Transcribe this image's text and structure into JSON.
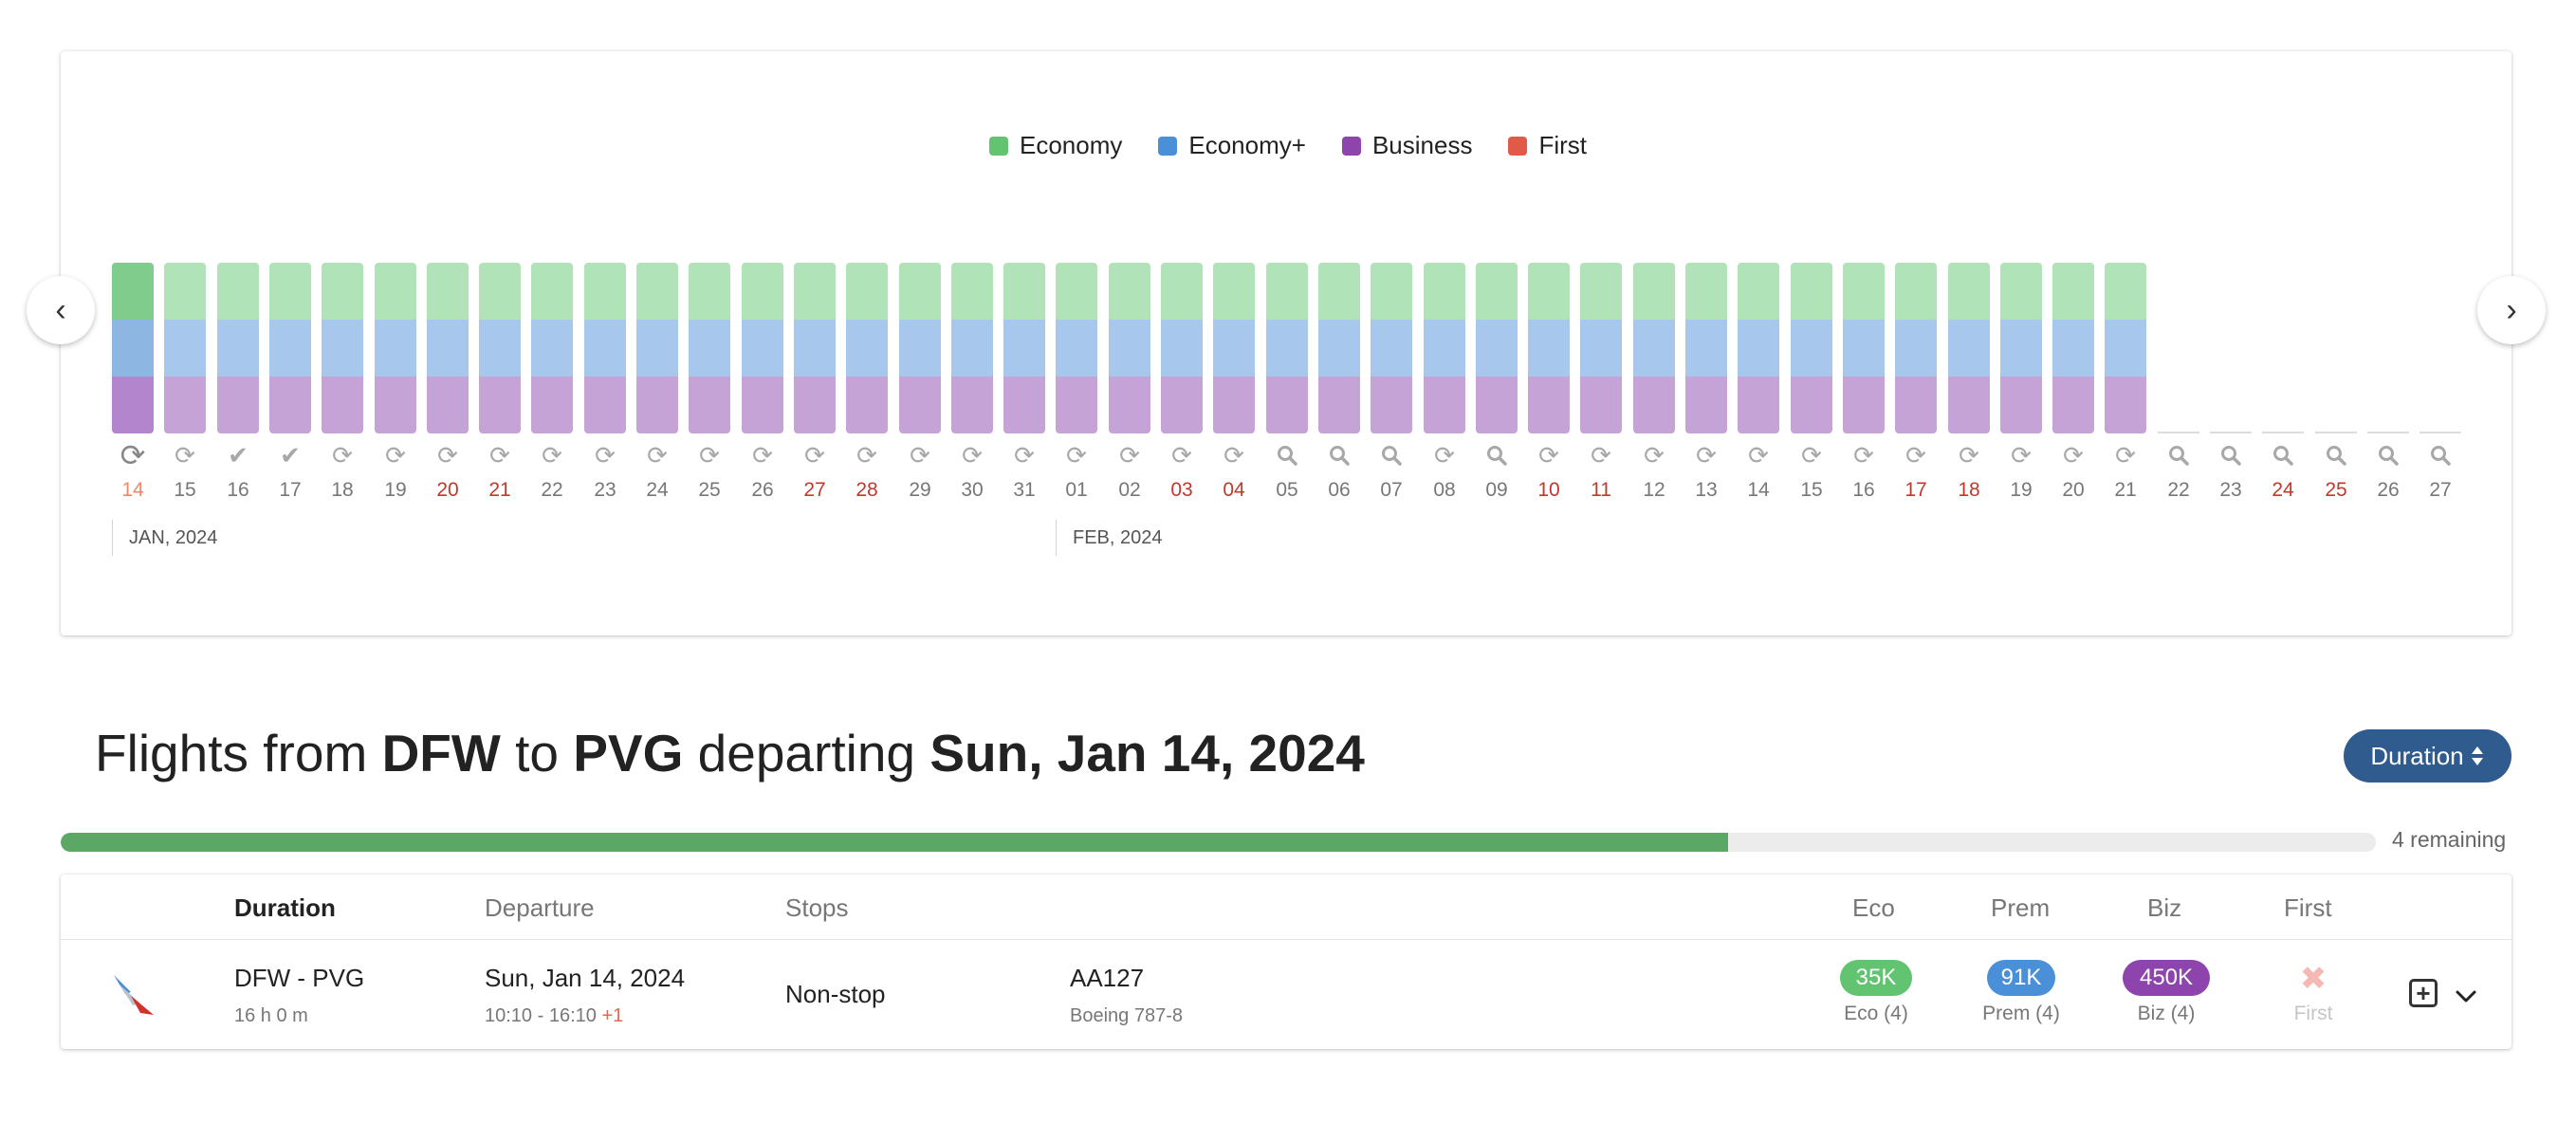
{
  "legend": [
    {
      "label": "Economy",
      "color": "#62c370"
    },
    {
      "label": "Economy+",
      "color": "#4a90d9"
    },
    {
      "label": "Business",
      "color": "#8e44ad"
    },
    {
      "label": "First",
      "color": "#e05a47"
    }
  ],
  "calendar": {
    "prev_icon": "chevron-left-icon",
    "next_icon": "chevron-right-icon",
    "bar_colors": {
      "economy": "#b1e3b9",
      "economy_plus": "#a7c8ec",
      "business": "#c5a3d6",
      "selected_economy": "#7fcc8c",
      "selected_economy_plus": "#8db6e3",
      "selected_business": "#b285cc"
    },
    "days": [
      {
        "label": "14",
        "status": "loading",
        "bar": true,
        "weekend": false,
        "selected": true
      },
      {
        "label": "15",
        "status": "refresh",
        "bar": true,
        "weekend": false
      },
      {
        "label": "16",
        "status": "done",
        "bar": true,
        "weekend": false
      },
      {
        "label": "17",
        "status": "done",
        "bar": true,
        "weekend": false
      },
      {
        "label": "18",
        "status": "refresh",
        "bar": true,
        "weekend": false
      },
      {
        "label": "19",
        "status": "refresh",
        "bar": true,
        "weekend": false
      },
      {
        "label": "20",
        "status": "refresh",
        "bar": true,
        "weekend": true
      },
      {
        "label": "21",
        "status": "refresh",
        "bar": true,
        "weekend": true
      },
      {
        "label": "22",
        "status": "refresh",
        "bar": true,
        "weekend": false
      },
      {
        "label": "23",
        "status": "refresh",
        "bar": true,
        "weekend": false
      },
      {
        "label": "24",
        "status": "refresh",
        "bar": true,
        "weekend": false
      },
      {
        "label": "25",
        "status": "refresh",
        "bar": true,
        "weekend": false
      },
      {
        "label": "26",
        "status": "refresh",
        "bar": true,
        "weekend": false
      },
      {
        "label": "27",
        "status": "refresh",
        "bar": true,
        "weekend": true
      },
      {
        "label": "28",
        "status": "refresh",
        "bar": true,
        "weekend": true
      },
      {
        "label": "29",
        "status": "refresh",
        "bar": true,
        "weekend": false
      },
      {
        "label": "30",
        "status": "refresh",
        "bar": true,
        "weekend": false
      },
      {
        "label": "31",
        "status": "refresh",
        "bar": true,
        "weekend": false
      },
      {
        "label": "01",
        "status": "refresh",
        "bar": true,
        "weekend": false
      },
      {
        "label": "02",
        "status": "refresh",
        "bar": true,
        "weekend": false
      },
      {
        "label": "03",
        "status": "refresh",
        "bar": true,
        "weekend": true
      },
      {
        "label": "04",
        "status": "refresh",
        "bar": true,
        "weekend": true
      },
      {
        "label": "05",
        "status": "search",
        "bar": true,
        "weekend": false
      },
      {
        "label": "06",
        "status": "search",
        "bar": true,
        "weekend": false
      },
      {
        "label": "07",
        "status": "search",
        "bar": true,
        "weekend": false
      },
      {
        "label": "08",
        "status": "refresh",
        "bar": true,
        "weekend": false
      },
      {
        "label": "09",
        "status": "search",
        "bar": true,
        "weekend": false
      },
      {
        "label": "10",
        "status": "refresh",
        "bar": true,
        "weekend": true
      },
      {
        "label": "11",
        "status": "refresh",
        "bar": true,
        "weekend": true
      },
      {
        "label": "12",
        "status": "refresh",
        "bar": true,
        "weekend": false
      },
      {
        "label": "13",
        "status": "refresh",
        "bar": true,
        "weekend": false
      },
      {
        "label": "14",
        "status": "refresh",
        "bar": true,
        "weekend": false
      },
      {
        "label": "15",
        "status": "refresh",
        "bar": true,
        "weekend": false
      },
      {
        "label": "16",
        "status": "refresh",
        "bar": true,
        "weekend": false
      },
      {
        "label": "17",
        "status": "refresh",
        "bar": true,
        "weekend": true
      },
      {
        "label": "18",
        "status": "refresh",
        "bar": true,
        "weekend": true
      },
      {
        "label": "19",
        "status": "refresh",
        "bar": true,
        "weekend": false
      },
      {
        "label": "20",
        "status": "refresh",
        "bar": true,
        "weekend": false
      },
      {
        "label": "21",
        "status": "refresh",
        "bar": true,
        "weekend": false
      },
      {
        "label": "22",
        "status": "search",
        "bar": false,
        "weekend": false
      },
      {
        "label": "23",
        "status": "search",
        "bar": false,
        "weekend": false
      },
      {
        "label": "24",
        "status": "search",
        "bar": false,
        "weekend": true
      },
      {
        "label": "25",
        "status": "search",
        "bar": false,
        "weekend": true
      },
      {
        "label": "26",
        "status": "search",
        "bar": false,
        "weekend": false
      },
      {
        "label": "27",
        "status": "search",
        "bar": false,
        "weekend": false
      }
    ],
    "months": [
      {
        "label": "JAN, 2024",
        "start_index": 0
      },
      {
        "label": "FEB, 2024",
        "start_index": 18
      }
    ]
  },
  "results": {
    "title_prefix": "Flights from",
    "origin": "DFW",
    "title_to": "to",
    "destination": "PVG",
    "title_departing": "departing",
    "date": "Sun, Jan 14, 2024",
    "sort_label": "Duration",
    "progress_percent": 72,
    "remaining_text": "4 remaining"
  },
  "table": {
    "headers": {
      "duration": "Duration",
      "departure": "Departure",
      "stops": "Stops",
      "eco": "Eco",
      "prem": "Prem",
      "biz": "Biz",
      "first": "First"
    },
    "rows": [
      {
        "airline_logo": "american-airlines-logo",
        "route": "DFW - PVG",
        "duration": "16 h 0 m",
        "date": "Sun, Jan 14, 2024",
        "times": "10:10 - 16:10",
        "day_offset": "+1",
        "stops": "Non-stop",
        "flight_number": "AA127",
        "aircraft": "Boeing 787-8",
        "eco": {
          "price": "35K",
          "seats": "Eco (4)",
          "color": "#62c370"
        },
        "prem": {
          "price": "91K",
          "seats": "Prem (4)",
          "color": "#4a90d9"
        },
        "biz": {
          "price": "450K",
          "seats": "Biz (4)",
          "color": "#8e44ad"
        },
        "first": {
          "seats": "First",
          "available": false
        }
      }
    ]
  }
}
